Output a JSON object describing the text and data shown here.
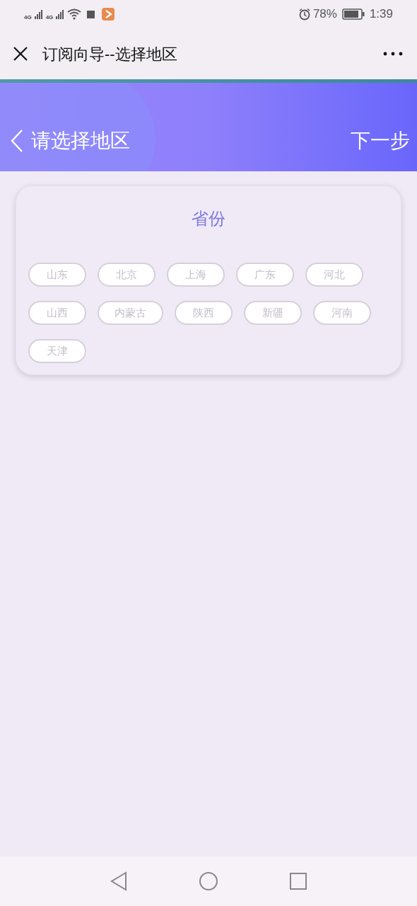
{
  "status_bar": {
    "network_1": "4G",
    "network_2": "4G",
    "battery": "78%",
    "time": "1:39"
  },
  "app_bar": {
    "title": "订阅向导--选择地区"
  },
  "header": {
    "title": "请选择地区",
    "next": "下一步"
  },
  "card": {
    "title": "省份",
    "regions": [
      {
        "label": "山东",
        "selected": false
      },
      {
        "label": "北京",
        "selected": false
      },
      {
        "label": "上海",
        "selected": false
      },
      {
        "label": "广东",
        "selected": false
      },
      {
        "label": "河北",
        "selected": false
      },
      {
        "label": "山西",
        "selected": false
      },
      {
        "label": "内蒙古",
        "selected": false
      },
      {
        "label": "陕西",
        "selected": false
      },
      {
        "label": "新疆",
        "selected": false
      },
      {
        "label": "河南",
        "selected": false
      },
      {
        "label": "天津",
        "selected": false
      }
    ]
  }
}
